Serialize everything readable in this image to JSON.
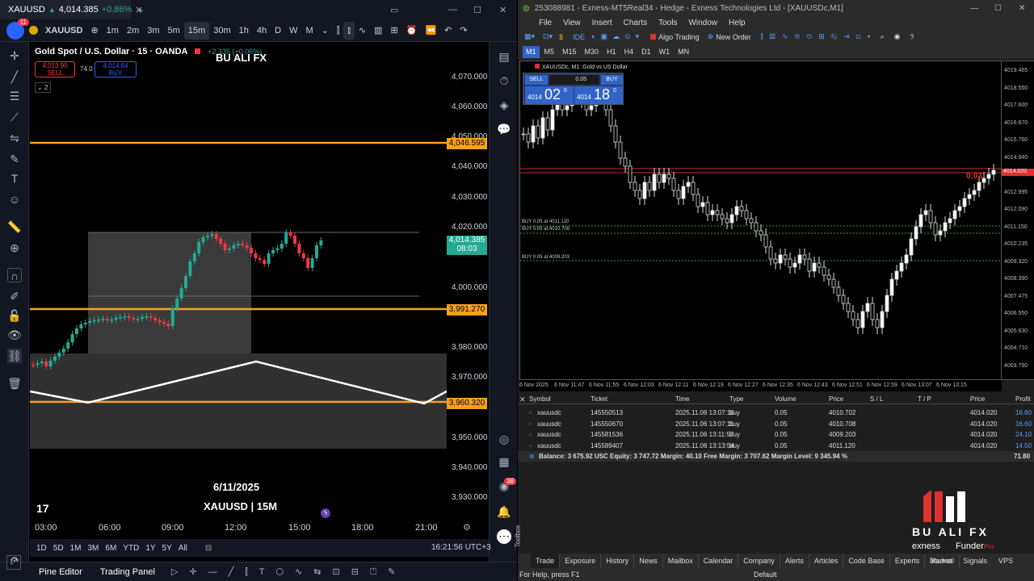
{
  "tv": {
    "tab_title": "XAUUSD",
    "tab_price": "4,014.385",
    "tab_change": "+0.86%",
    "symbol": "XAUUSD",
    "timeframes": [
      "1m",
      "2m",
      "3m",
      "5m",
      "15m",
      "30m",
      "1h",
      "4h",
      "D",
      "W",
      "M"
    ],
    "active_tf": "15m",
    "legend_title": "Gold Spot / U.S. Dollar · 15 · OANDA",
    "legend_change": "+2.335 (+0.06%)",
    "sell_price": "4,013.90",
    "sell_label": "SELL",
    "spread": "74.0",
    "buy_price": "4,014.64",
    "buy_label": "BUY",
    "indicator_count": "2",
    "watermark": "BU ALI FX",
    "price_labels": [
      "4,070.000",
      "4,060.000",
      "4,050.000",
      "4,040.000",
      "4,030.000",
      "4,020.000",
      "4,000.000",
      "3,980.000",
      "3,970.000",
      "3,950.000",
      "3,940.000",
      "3,930.000"
    ],
    "level_high": "4,046.595",
    "level_mid": "3,991.270",
    "level_low": "3,960.320",
    "current_price": "4,014.385",
    "countdown": "08:03",
    "date_text": "6/11/2025",
    "chart_caption": "XAUUSD | 15M",
    "time_labels": [
      "03:00",
      "06:00",
      "09:00",
      "12:00",
      "15:00",
      "18:00",
      "21:00"
    ],
    "ranges": [
      "1D",
      "5D",
      "1M",
      "3M",
      "6M",
      "YTD",
      "1Y",
      "5Y",
      "All"
    ],
    "clock": "16:21:56 UTC+3",
    "bottom_tabs": [
      "Pine Editor",
      "Trading Panel"
    ],
    "alerts_badge": "38",
    "notif_badge": "11"
  },
  "mt": {
    "title": "253088981 - Exness-MT5Real34 - Hedge - Exness Technologies Ltd - [XAUUSDc,M1]",
    "menu": [
      "File",
      "View",
      "Insert",
      "Charts",
      "Tools",
      "Window",
      "Help"
    ],
    "algo": "Algo Trading",
    "new_order": "New Order",
    "ide": "IDE",
    "tfs": [
      "M1",
      "M5",
      "M15",
      "M30",
      "H1",
      "H4",
      "D1",
      "W1",
      "MN"
    ],
    "active_tf": "M1",
    "chart_label": "XAUUSDc, M1:  Gold vs US Dollar",
    "sell": "SELL",
    "buy": "BUY",
    "lot": "0.05",
    "bid_big": "02",
    "bid_prefix": "4014",
    "ask_big": "18",
    "ask_prefix": "4014",
    "sup": "0",
    "timer": "0:03",
    "buy_lines": [
      "BUY 0.05 at 4011.120",
      "BUY 0.05 at 4010.708",
      "BUY 0.05 at 4009.203"
    ],
    "yaxis": [
      "4019.465",
      "4018.550",
      "4017.600",
      "4016.670",
      "4015.760",
      "4014.840",
      "4013.920",
      "4012.995",
      "4012.090",
      "4011.150",
      "4010.235",
      "4009.320",
      "4008.390",
      "4007.475",
      "4006.550",
      "4005.630",
      "4004.710",
      "4003.790"
    ],
    "current_box": "4014.020",
    "xaxis": [
      "6 Nov 2025",
      "6 Nov 11:47",
      "6 Nov 11:55",
      "6 Nov 12:03",
      "6 Nov 12:11",
      "6 Nov 12:19",
      "6 Nov 12:27",
      "6 Nov 12:35",
      "6 Nov 12:43",
      "6 Nov 12:51",
      "6 Nov 12:59",
      "6 Nov 13:07",
      "6 Nov 13:15"
    ],
    "headers": [
      "Symbol",
      "Ticket",
      "Time",
      "Type",
      "Volume",
      "Price",
      "S / L",
      "T / P",
      "Price",
      "Profit"
    ],
    "rows": [
      [
        "xauusdc",
        "145550513",
        "2025.11.06 13:07:10",
        "buy",
        "0.05",
        "4010.702",
        "",
        "",
        "4014.020",
        "16.60"
      ],
      [
        "xauusdc",
        "145550670",
        "2025.11.06 13:07:11",
        "buy",
        "0.05",
        "4010.708",
        "",
        "",
        "4014.020",
        "16.60"
      ],
      [
        "xauusdc",
        "145581536",
        "2025.11.06 13:11:57",
        "buy",
        "0.05",
        "4009.203",
        "",
        "",
        "4014.020",
        "24.10"
      ],
      [
        "xauusdc",
        "145589407",
        "2025.11.06 13:13:54",
        "buy",
        "0.05",
        "4011.120",
        "",
        "",
        "4014.020",
        "14.50"
      ]
    ],
    "balance_line": "Balance: 3 675.92 USC  Equity: 3 747.72  Margin: 40.10  Free Margin: 3 707.62  Margin Level: 9 345.94 %",
    "total_profit": "71.80",
    "logo_name": "BU ALI FX",
    "logo_sub1": "exness",
    "logo_sub2": "Funder",
    "logo_sub2b": "Pro",
    "tabs": [
      "Trade",
      "Exposure",
      "History",
      "News",
      "Mailbox",
      "Calendar",
      "Company",
      "Alerts",
      "Articles",
      "Code Base",
      "Experts",
      "Journal"
    ],
    "right_tabs": [
      "Market",
      "Signals",
      "VPS"
    ],
    "toolbox": "Toolbox",
    "status_left": "For Help, press F1",
    "status_mid": "Default"
  },
  "colors": {
    "orange": "#f7a21b",
    "green": "#22ab94",
    "red": "#f23645",
    "mtblue": "#3264c8"
  }
}
